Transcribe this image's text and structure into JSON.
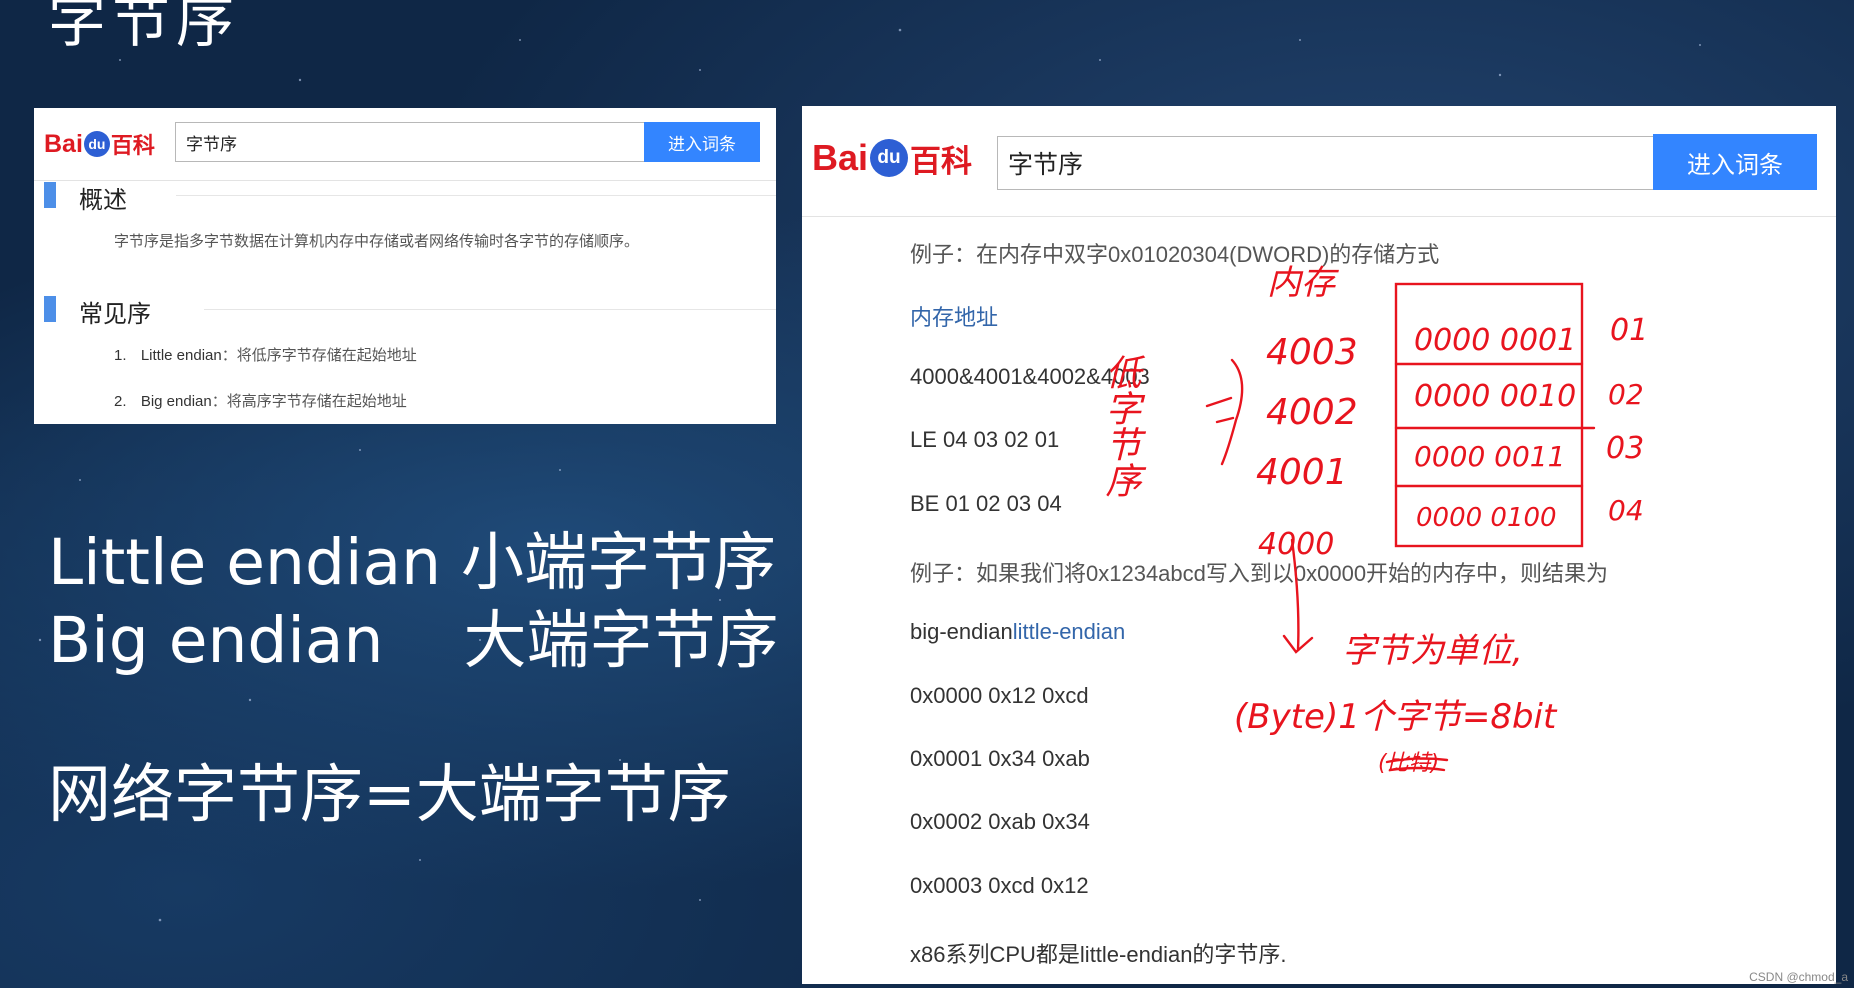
{
  "slide": {
    "title": "字节序",
    "line1": "Little endian 小端字节序",
    "line2": "Big endian    大端字节序",
    "line3": "网络字节序=大端字节序"
  },
  "baike_small": {
    "logo_bai": "Bai",
    "logo_du": "du",
    "logo_baike": "百科",
    "search_value": "字节序",
    "search_button": "进入词条",
    "section1_title": "概述",
    "section1_text": "字节序是指多字节数据在计算机内存中存储或者网络传输时各字节的存储顺序。",
    "section2_title": "常见序",
    "items": [
      {
        "num": "1.",
        "en": "Little endian",
        "zh": "：将低序字节存储在起始地址"
      },
      {
        "num": "2.",
        "en": "Big endian",
        "zh": "：将高序字节存储在起始地址"
      }
    ]
  },
  "baike_large": {
    "logo_bai": "Bai",
    "logo_du": "du",
    "logo_baike": "百科",
    "search_value": "字节序",
    "search_button": "进入词条",
    "lines": [
      "例子：在内存中双字0x01020304(DWORD)的存储方式",
      "内存地址",
      "4000&4001&4002&4003",
      "LE 04 03 02 01",
      "BE 01 02 03 04",
      "例子：如果我们将0x1234abcd写入到以0x0000开始的内存中，则结果为",
      "big-endian",
      "little-endian",
      "0x0000 0x12 0xcd",
      "0x0001 0x34 0xab",
      "0x0002 0xab 0x34",
      "0x0003 0xcd 0x12",
      "x86系列CPU都是little-endian的字节序."
    ]
  },
  "annotations": {
    "col_label": "内存",
    "side_label": "低字节序",
    "addresses": [
      "4003",
      "4002",
      "4001",
      "4000"
    ],
    "cells": [
      "0000 0001",
      "0000 0010",
      "0000 0011",
      "0000 0100"
    ],
    "right_values": [
      "01",
      "02",
      "03",
      "04"
    ],
    "unit_note": "字节为单位,",
    "byte_note": "(Byte)1个字节=8bit",
    "paren_note": "(比特)"
  },
  "watermark": "CSDN @chmod_a",
  "colors": {
    "background": "#0f2746",
    "baidu_red": "#de1a22",
    "baidu_blue": "#2d5fd4",
    "button_blue": "#3385ff",
    "annotation_red": "#e8141e",
    "link_blue": "#3366aa"
  }
}
